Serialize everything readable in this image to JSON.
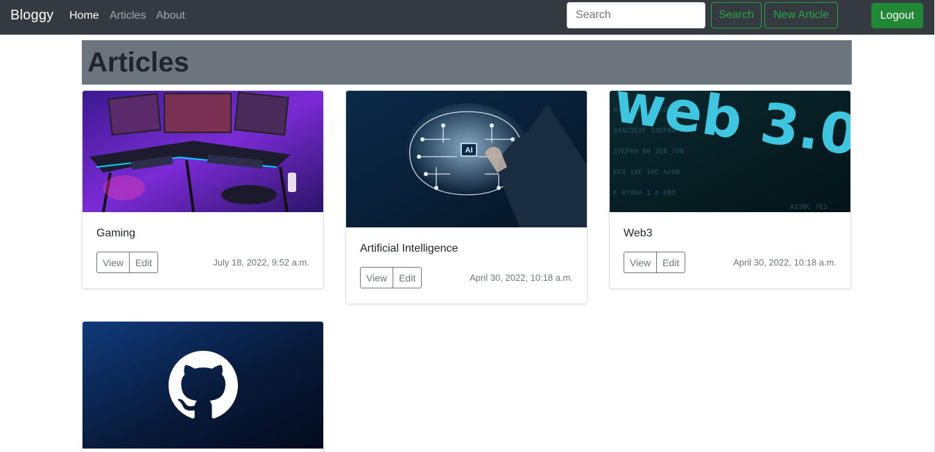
{
  "nav": {
    "brand": "Bloggy",
    "links": [
      "Home",
      "Articles",
      "About"
    ],
    "search_placeholder": "Search",
    "search_button": "Search",
    "new_article_button": "New Article",
    "logout_button": "Logout"
  },
  "page": {
    "title": "Articles"
  },
  "articles": [
    {
      "title": "Gaming",
      "view_label": "View",
      "edit_label": "Edit",
      "date": "July 18, 2022, 9:52 a.m.",
      "image_icon": "gaming-setup-image"
    },
    {
      "title": "Artificial Intelligence",
      "view_label": "View",
      "edit_label": "Edit",
      "date": "April 30, 2022, 10:18 a.m.",
      "image_icon": "ai-brain-image",
      "image_text": "AI"
    },
    {
      "title": "Web3",
      "view_label": "View",
      "edit_label": "Edit",
      "date": "April 30, 2022, 10:18 a.m.",
      "image_icon": "web3-image",
      "image_text": "web 3.0"
    },
    {
      "image_icon": "github-logo-image"
    }
  ],
  "colors": {
    "navbar": "#343a40",
    "accent": "#28a745",
    "logout": "#218838",
    "header_bar": "#6c757d"
  }
}
